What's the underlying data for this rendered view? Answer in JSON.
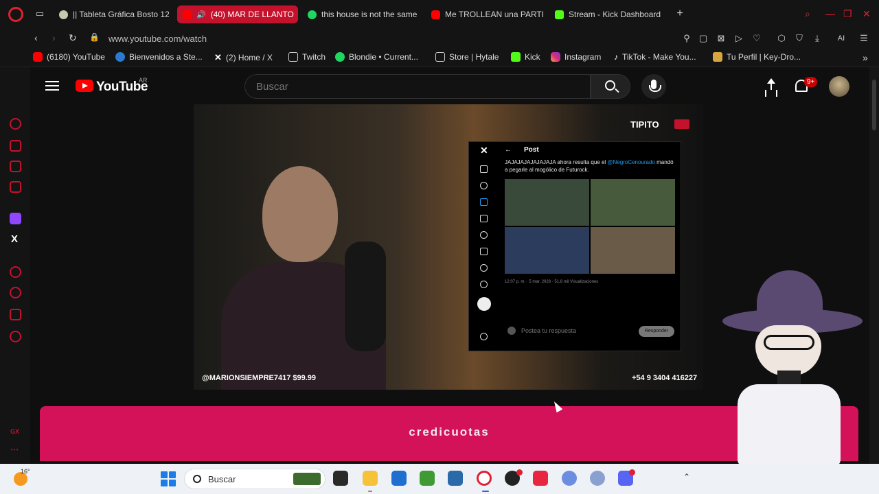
{
  "browser": {
    "tabs": [
      {
        "label": "|| Tableta Gráfica Bosto 12",
        "favicon": "grey",
        "active": false
      },
      {
        "label": "(40) MAR DE LLANTO",
        "favicon": "yt",
        "active": true
      },
      {
        "label": "this house is not the same",
        "favicon": "spot",
        "active": false
      },
      {
        "label": "Me TROLLEAN una PARTI",
        "favicon": "yt",
        "active": false
      },
      {
        "label": "Stream - Kick Dashboard",
        "favicon": "kick",
        "active": false
      }
    ],
    "new_tab": "+",
    "url": "www.youtube.com/watch",
    "ai_label": "AI",
    "bookmarks": [
      {
        "label": "(6180) YouTube",
        "favicon": "yt"
      },
      {
        "label": "Bienvenidos a Ste...",
        "favicon": "grey"
      },
      {
        "label": "(2) Home / X",
        "favicon": "x"
      },
      {
        "label": "Twitch",
        "favicon": "doc"
      },
      {
        "label": "Blondie • Current...",
        "favicon": "spot"
      },
      {
        "label": "Store | Hytale",
        "favicon": "doc"
      },
      {
        "label": "Kick",
        "favicon": "kick"
      },
      {
        "label": "Instagram",
        "favicon": "insta"
      },
      {
        "label": "TikTok - Make You...",
        "favicon": "tiktok"
      },
      {
        "label": "Tu Perfil | Key-Dro...",
        "favicon": "grey"
      }
    ],
    "bookmarks_more": "»"
  },
  "sidebar": {
    "x_label": "X",
    "gx_label": "GX"
  },
  "youtube": {
    "logo_text": "YouTube",
    "country": "AR",
    "search_placeholder": "Buscar",
    "notification_count": "9+"
  },
  "video": {
    "brand": "TIPITO",
    "superchat": "@MARIONSIEMPRE7417 $99.99",
    "phone": "+54 9 3404 416227",
    "xpost": {
      "back": "←",
      "title": "Post",
      "text_before": "JAJAJAJAJAJAJAJA ahora resulta que el ",
      "mention": "@NegroCenourado",
      "text_after": "mandó a pegarle al mogólico de Futurock.",
      "meta": "12:07 p. m. · 5 mar. 2026 · 51,8 mil Visualizaciones",
      "reply_placeholder": "Postea tu respuesta",
      "reply_button": "Responder"
    }
  },
  "ad": {
    "text": "credicuotas",
    "color": "#d3125a"
  },
  "taskbar": {
    "temperature": "16°",
    "search_label": "Buscar"
  },
  "colors": {
    "opera_red": "#c4122c",
    "youtube_red": "#ff0000"
  }
}
